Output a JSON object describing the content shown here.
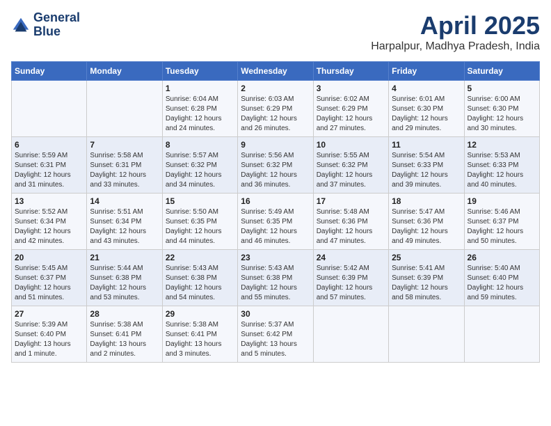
{
  "logo": {
    "line1": "General",
    "line2": "Blue"
  },
  "title": "April 2025",
  "subtitle": "Harpalpur, Madhya Pradesh, India",
  "weekdays": [
    "Sunday",
    "Monday",
    "Tuesday",
    "Wednesday",
    "Thursday",
    "Friday",
    "Saturday"
  ],
  "weeks": [
    [
      {
        "day": "",
        "sunrise": "",
        "sunset": "",
        "daylight": ""
      },
      {
        "day": "",
        "sunrise": "",
        "sunset": "",
        "daylight": ""
      },
      {
        "day": "1",
        "sunrise": "Sunrise: 6:04 AM",
        "sunset": "Sunset: 6:28 PM",
        "daylight": "Daylight: 12 hours and 24 minutes."
      },
      {
        "day": "2",
        "sunrise": "Sunrise: 6:03 AM",
        "sunset": "Sunset: 6:29 PM",
        "daylight": "Daylight: 12 hours and 26 minutes."
      },
      {
        "day": "3",
        "sunrise": "Sunrise: 6:02 AM",
        "sunset": "Sunset: 6:29 PM",
        "daylight": "Daylight: 12 hours and 27 minutes."
      },
      {
        "day": "4",
        "sunrise": "Sunrise: 6:01 AM",
        "sunset": "Sunset: 6:30 PM",
        "daylight": "Daylight: 12 hours and 29 minutes."
      },
      {
        "day": "5",
        "sunrise": "Sunrise: 6:00 AM",
        "sunset": "Sunset: 6:30 PM",
        "daylight": "Daylight: 12 hours and 30 minutes."
      }
    ],
    [
      {
        "day": "6",
        "sunrise": "Sunrise: 5:59 AM",
        "sunset": "Sunset: 6:31 PM",
        "daylight": "Daylight: 12 hours and 31 minutes."
      },
      {
        "day": "7",
        "sunrise": "Sunrise: 5:58 AM",
        "sunset": "Sunset: 6:31 PM",
        "daylight": "Daylight: 12 hours and 33 minutes."
      },
      {
        "day": "8",
        "sunrise": "Sunrise: 5:57 AM",
        "sunset": "Sunset: 6:32 PM",
        "daylight": "Daylight: 12 hours and 34 minutes."
      },
      {
        "day": "9",
        "sunrise": "Sunrise: 5:56 AM",
        "sunset": "Sunset: 6:32 PM",
        "daylight": "Daylight: 12 hours and 36 minutes."
      },
      {
        "day": "10",
        "sunrise": "Sunrise: 5:55 AM",
        "sunset": "Sunset: 6:32 PM",
        "daylight": "Daylight: 12 hours and 37 minutes."
      },
      {
        "day": "11",
        "sunrise": "Sunrise: 5:54 AM",
        "sunset": "Sunset: 6:33 PM",
        "daylight": "Daylight: 12 hours and 39 minutes."
      },
      {
        "day": "12",
        "sunrise": "Sunrise: 5:53 AM",
        "sunset": "Sunset: 6:33 PM",
        "daylight": "Daylight: 12 hours and 40 minutes."
      }
    ],
    [
      {
        "day": "13",
        "sunrise": "Sunrise: 5:52 AM",
        "sunset": "Sunset: 6:34 PM",
        "daylight": "Daylight: 12 hours and 42 minutes."
      },
      {
        "day": "14",
        "sunrise": "Sunrise: 5:51 AM",
        "sunset": "Sunset: 6:34 PM",
        "daylight": "Daylight: 12 hours and 43 minutes."
      },
      {
        "day": "15",
        "sunrise": "Sunrise: 5:50 AM",
        "sunset": "Sunset: 6:35 PM",
        "daylight": "Daylight: 12 hours and 44 minutes."
      },
      {
        "day": "16",
        "sunrise": "Sunrise: 5:49 AM",
        "sunset": "Sunset: 6:35 PM",
        "daylight": "Daylight: 12 hours and 46 minutes."
      },
      {
        "day": "17",
        "sunrise": "Sunrise: 5:48 AM",
        "sunset": "Sunset: 6:36 PM",
        "daylight": "Daylight: 12 hours and 47 minutes."
      },
      {
        "day": "18",
        "sunrise": "Sunrise: 5:47 AM",
        "sunset": "Sunset: 6:36 PM",
        "daylight": "Daylight: 12 hours and 49 minutes."
      },
      {
        "day": "19",
        "sunrise": "Sunrise: 5:46 AM",
        "sunset": "Sunset: 6:37 PM",
        "daylight": "Daylight: 12 hours and 50 minutes."
      }
    ],
    [
      {
        "day": "20",
        "sunrise": "Sunrise: 5:45 AM",
        "sunset": "Sunset: 6:37 PM",
        "daylight": "Daylight: 12 hours and 51 minutes."
      },
      {
        "day": "21",
        "sunrise": "Sunrise: 5:44 AM",
        "sunset": "Sunset: 6:38 PM",
        "daylight": "Daylight: 12 hours and 53 minutes."
      },
      {
        "day": "22",
        "sunrise": "Sunrise: 5:43 AM",
        "sunset": "Sunset: 6:38 PM",
        "daylight": "Daylight: 12 hours and 54 minutes."
      },
      {
        "day": "23",
        "sunrise": "Sunrise: 5:43 AM",
        "sunset": "Sunset: 6:38 PM",
        "daylight": "Daylight: 12 hours and 55 minutes."
      },
      {
        "day": "24",
        "sunrise": "Sunrise: 5:42 AM",
        "sunset": "Sunset: 6:39 PM",
        "daylight": "Daylight: 12 hours and 57 minutes."
      },
      {
        "day": "25",
        "sunrise": "Sunrise: 5:41 AM",
        "sunset": "Sunset: 6:39 PM",
        "daylight": "Daylight: 12 hours and 58 minutes."
      },
      {
        "day": "26",
        "sunrise": "Sunrise: 5:40 AM",
        "sunset": "Sunset: 6:40 PM",
        "daylight": "Daylight: 12 hours and 59 minutes."
      }
    ],
    [
      {
        "day": "27",
        "sunrise": "Sunrise: 5:39 AM",
        "sunset": "Sunset: 6:40 PM",
        "daylight": "Daylight: 13 hours and 1 minute."
      },
      {
        "day": "28",
        "sunrise": "Sunrise: 5:38 AM",
        "sunset": "Sunset: 6:41 PM",
        "daylight": "Daylight: 13 hours and 2 minutes."
      },
      {
        "day": "29",
        "sunrise": "Sunrise: 5:38 AM",
        "sunset": "Sunset: 6:41 PM",
        "daylight": "Daylight: 13 hours and 3 minutes."
      },
      {
        "day": "30",
        "sunrise": "Sunrise: 5:37 AM",
        "sunset": "Sunset: 6:42 PM",
        "daylight": "Daylight: 13 hours and 5 minutes."
      },
      {
        "day": "",
        "sunrise": "",
        "sunset": "",
        "daylight": ""
      },
      {
        "day": "",
        "sunrise": "",
        "sunset": "",
        "daylight": ""
      },
      {
        "day": "",
        "sunrise": "",
        "sunset": "",
        "daylight": ""
      }
    ]
  ]
}
